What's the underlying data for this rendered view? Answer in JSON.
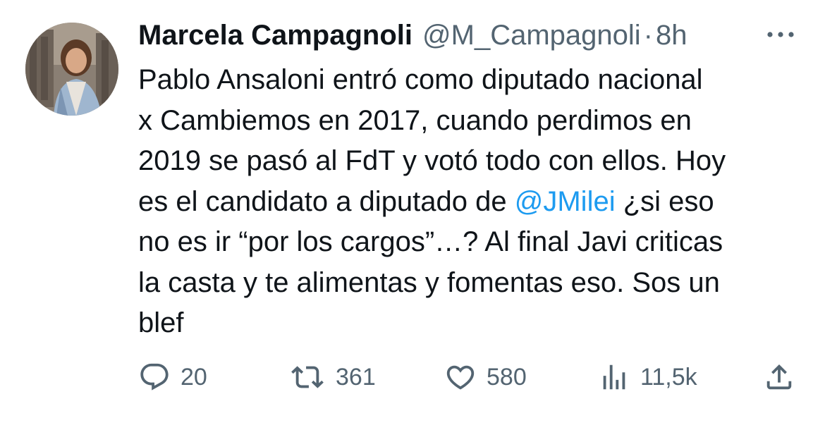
{
  "tweet": {
    "author_name": "Marcela Campagnoli",
    "author_handle": "@M_Campagnoli",
    "separator": "·",
    "time": "8h",
    "text_lines": [
      [
        "Pablo Ansaloni entró como diputado nacional"
      ],
      [
        "x Cambiemos en 2017, cuando perdimos en"
      ],
      [
        "2019 se pasó al FdT y votó todo con ellos. Hoy"
      ],
      [
        "es el candidato a diputado de ",
        "@JMilei",
        " ¿si eso"
      ],
      [
        "no es ir “por los cargos”…? Al final Javi criticas"
      ],
      [
        "la casta y te alimentas y fomentas eso. Sos un"
      ],
      [
        "blef"
      ]
    ],
    "mention": "@JMilei"
  },
  "actions": {
    "reply": {
      "icon": "reply-icon",
      "count": "20"
    },
    "retweet": {
      "icon": "retweet-icon",
      "count": "361"
    },
    "like": {
      "icon": "heart-icon",
      "count": "580"
    },
    "views": {
      "icon": "views-chart-icon",
      "count": "11,5k"
    },
    "share": {
      "icon": "share-icon"
    }
  },
  "colors": {
    "text": "#0f1419",
    "secondary": "#536471",
    "link": "#1d9bf0",
    "background": "#ffffff"
  }
}
